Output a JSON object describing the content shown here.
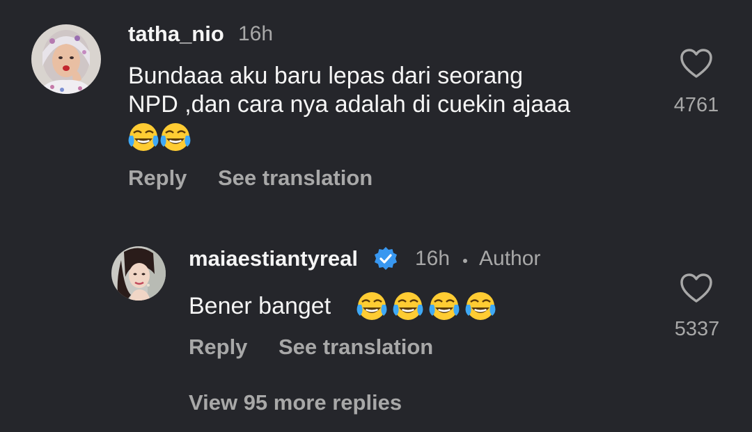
{
  "comment1": {
    "username": "tatha_nio",
    "time": "16h",
    "text_line1": "Bundaaa aku baru lepas dari seorang",
    "text_line2": "NPD ,dan cara nya adalah di cuekin ajaaa",
    "emoji": "face-with-tears-of-joy",
    "emoji_count": 2,
    "like_count": "4761",
    "reply_label": "Reply",
    "translate_label": "See translation"
  },
  "reply1": {
    "username": "maiaestiantyreal",
    "time": "16h",
    "author_badge": "Author",
    "text": "Bener banget",
    "emoji": "face-with-tears-of-joy",
    "emoji_count": 4,
    "like_count": "5337",
    "reply_label": "Reply",
    "translate_label": "See translation",
    "verified_color": "#3897f0"
  },
  "view_more_replies": "View 95 more replies",
  "colors": {
    "background": "#25262b",
    "primary_text": "#f5f5f5",
    "secondary_text": "#a8a8a8",
    "verified": "#3897f0"
  }
}
